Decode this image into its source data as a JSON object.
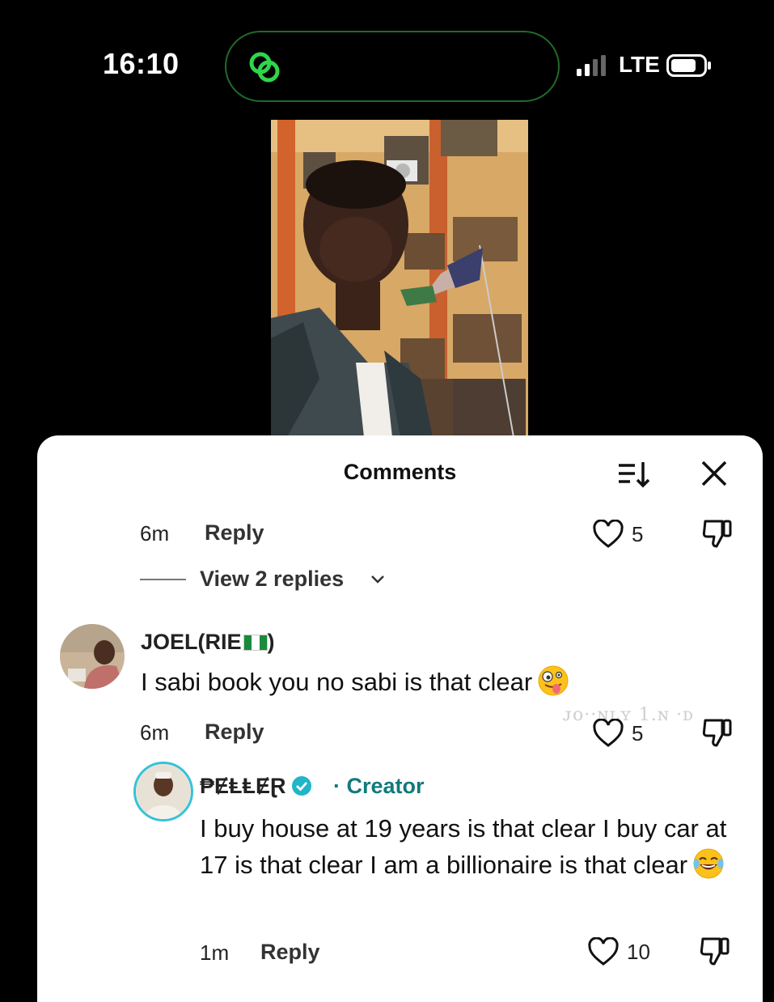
{
  "status_bar": {
    "time": "16:10",
    "network": "LTE"
  },
  "comments_sheet": {
    "title": "Comments",
    "comments": [
      {
        "time": "6m",
        "reply_label": "Reply",
        "likes": "5",
        "view_replies": "View 2 replies"
      },
      {
        "author": "JOEL(RIE",
        "author_suffix": ")",
        "text": "I sabi book you no sabi is that clear",
        "time": "6m",
        "reply_label": "Reply",
        "likes": "5"
      },
      {
        "author": "₱ɆⱠⱠɆⱤ",
        "badge_sep": "·",
        "badge": "Creator",
        "text": "I buy house at 19 years is that clear I buy car at 17 is that clear I am a billionaire is that clear",
        "time": "1m",
        "reply_label": "Reply",
        "likes": "10"
      }
    ]
  },
  "icons": [
    "island-app-icon",
    "signal-icon",
    "battery-icon",
    "sort-icon",
    "close-icon",
    "heart-icon",
    "thumbs-down-icon",
    "chevron-down-icon",
    "nigeria-flag-icon",
    "zany-face-emoji",
    "laughing-emoji",
    "verified-icon"
  ],
  "colors": {
    "creator": "#117a7d",
    "avatar_ring": "#35c2d8",
    "island_border": "#1f6b2a",
    "island_icon": "#2fd54a"
  }
}
